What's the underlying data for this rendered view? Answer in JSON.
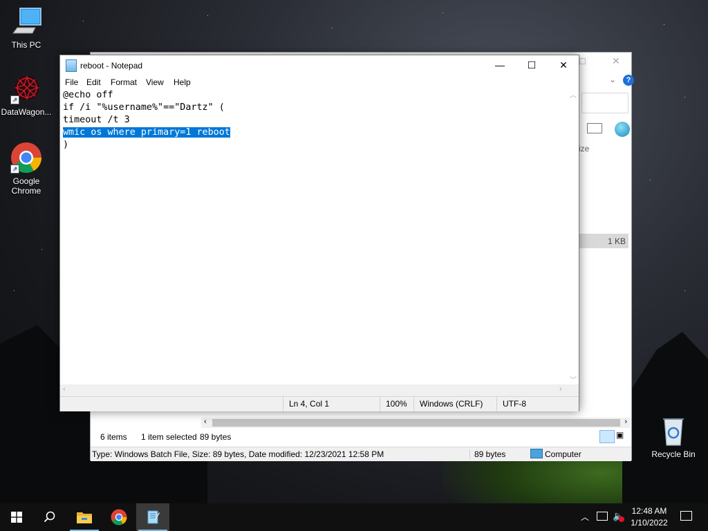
{
  "desktop": {
    "icons": [
      {
        "label": "This PC",
        "icon": "computer-icon"
      },
      {
        "label": "DataWagon...",
        "icon": "datawagon-app-icon"
      },
      {
        "label": "Google Chrome",
        "icon": "chrome-icon"
      },
      {
        "label": "Recycle Bin",
        "icon": "recycle-bin-icon"
      }
    ]
  },
  "notepad": {
    "title": "reboot - Notepad",
    "menu": [
      "File",
      "Edit",
      "Format",
      "View",
      "Help"
    ],
    "lines": [
      "@echo off",
      "if /i \"%username%\"==\"Dartz\" (",
      "timeout /t 3",
      "wmic os where primary=1 reboot",
      ")"
    ],
    "selected_line_index": 3,
    "status": {
      "position": "Ln 4, Col 1",
      "zoom": "100%",
      "line_ending": "Windows (CRLF)",
      "encoding": "UTF-8"
    }
  },
  "explorer": {
    "column_header_partial": "ize",
    "file_size_partial": "1 KB",
    "status": {
      "items": "6 items",
      "selected": "1 item selected",
      "size": "89 bytes"
    },
    "details": {
      "info": "Type: Windows Batch File, Size: 89 bytes, Date modified: 12/23/2021 12:58 PM",
      "size": "89 bytes",
      "location": "Computer"
    }
  },
  "taskbar": {
    "time": "12:48 AM",
    "date": "1/10/2022",
    "pinned": [
      "start-icon",
      "search-icon",
      "file-explorer-icon",
      "chrome-icon",
      "notepad-icon"
    ]
  },
  "colors": {
    "selection": "#0078d7",
    "taskbar": "#101010",
    "accent": "#76b9ed"
  }
}
